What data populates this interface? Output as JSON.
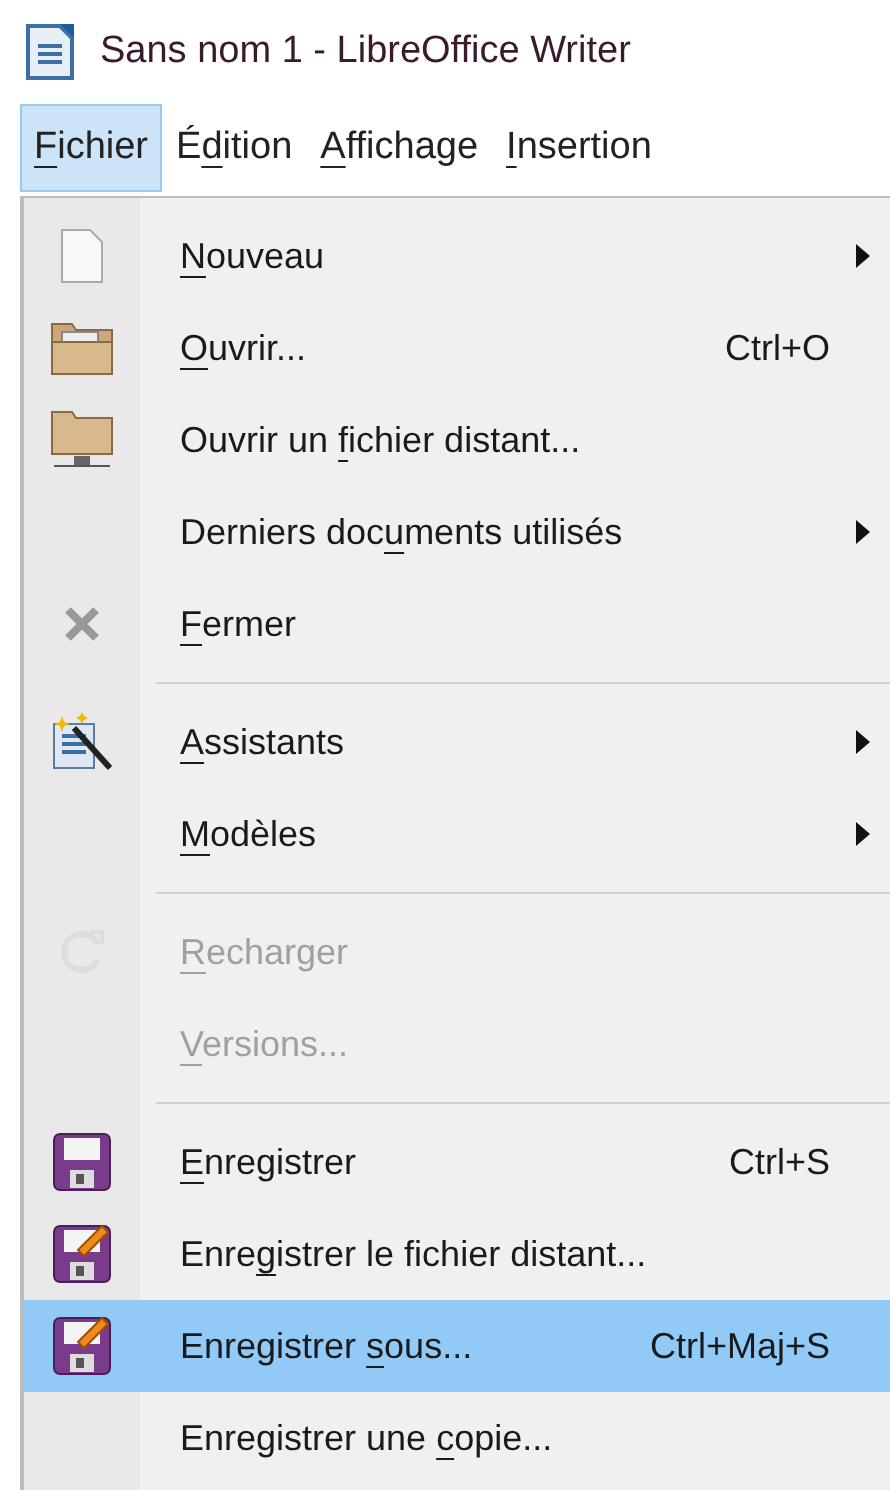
{
  "window": {
    "title": "Sans nom 1 - LibreOffice Writer"
  },
  "menubar": [
    {
      "label": {
        "key": "F",
        "post": "ichier"
      },
      "selected": true
    },
    {
      "label": {
        "pre": "É",
        "key": "d",
        "post": "ition"
      },
      "selected": false
    },
    {
      "label": {
        "key": "A",
        "post": "ffichage"
      },
      "selected": false
    },
    {
      "label": {
        "key": "I",
        "post": "nsertion"
      },
      "selected": false
    }
  ],
  "menu": [
    {
      "kind": "item",
      "label": {
        "key": "N",
        "post": "ouveau"
      },
      "submenu": true,
      "disabled": false,
      "selected": false
    },
    {
      "kind": "item",
      "label": {
        "key": "O",
        "post": "uvrir..."
      },
      "shortcut": "Ctrl+O",
      "submenu": false,
      "disabled": false,
      "selected": false
    },
    {
      "kind": "item",
      "label": {
        "pre": "Ouvrir un ",
        "key": "f",
        "post": "ichier distant..."
      },
      "submenu": false,
      "disabled": false,
      "selected": false
    },
    {
      "kind": "item",
      "label": {
        "pre": "Derniers doc",
        "key": "u",
        "post": "ments utilisés"
      },
      "submenu": true,
      "disabled": false,
      "selected": false
    },
    {
      "kind": "item",
      "label": {
        "key": "F",
        "post": "ermer"
      },
      "submenu": false,
      "disabled": false,
      "selected": false
    },
    {
      "kind": "separator"
    },
    {
      "kind": "item",
      "label": {
        "key": "A",
        "post": "ssistants"
      },
      "submenu": true,
      "disabled": false,
      "selected": false
    },
    {
      "kind": "item",
      "label": {
        "key": "M",
        "post": "odèles"
      },
      "submenu": true,
      "disabled": false,
      "selected": false
    },
    {
      "kind": "separator"
    },
    {
      "kind": "item",
      "label": {
        "key": "R",
        "post": "echarger"
      },
      "submenu": false,
      "disabled": true,
      "selected": false
    },
    {
      "kind": "item",
      "label": {
        "key": "V",
        "post": "ersions..."
      },
      "submenu": false,
      "disabled": true,
      "selected": false
    },
    {
      "kind": "separator"
    },
    {
      "kind": "item",
      "label": {
        "key": "E",
        "post": "nregistrer"
      },
      "shortcut": "Ctrl+S",
      "submenu": false,
      "disabled": false,
      "selected": false
    },
    {
      "kind": "item",
      "label": {
        "pre": "Enre",
        "key": "g",
        "post": "istrer le fichier distant..."
      },
      "submenu": false,
      "disabled": false,
      "selected": false
    },
    {
      "kind": "item",
      "label": {
        "pre": "Enregistrer ",
        "key": "s",
        "post": "ous..."
      },
      "shortcut": "Ctrl+Maj+S",
      "submenu": false,
      "disabled": false,
      "selected": true
    },
    {
      "kind": "item",
      "label": {
        "pre": "Enregistrer une ",
        "key": "c",
        "post": "opie..."
      },
      "submenu": false,
      "disabled": false,
      "selected": false
    }
  ]
}
